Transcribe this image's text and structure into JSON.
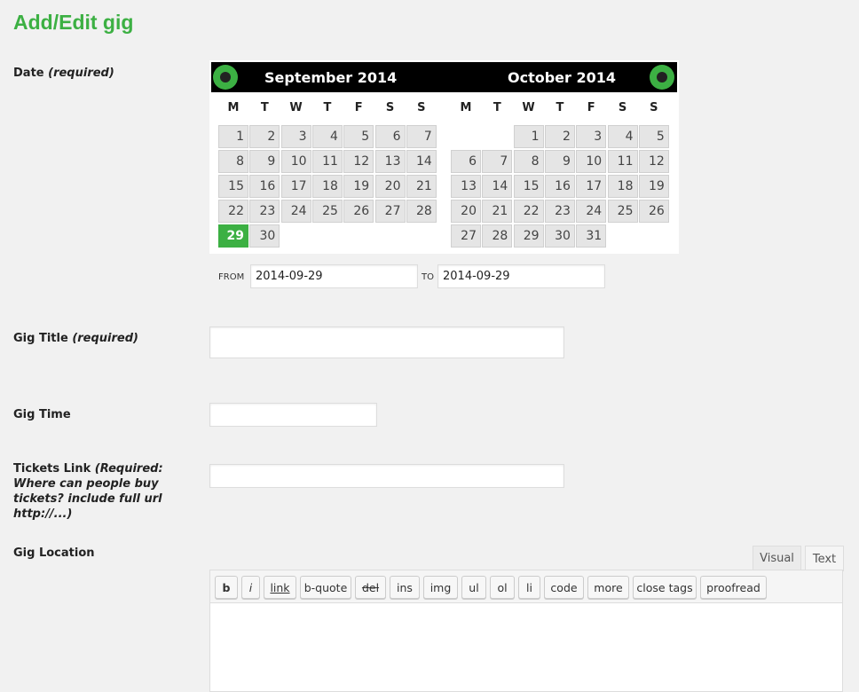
{
  "page_title": "Add/Edit gig",
  "fields": {
    "date": {
      "label": "Date",
      "note": "(required)"
    },
    "title": {
      "label": "Gig Title",
      "note": "(required)",
      "value": ""
    },
    "time": {
      "label": "Gig Time",
      "value": ""
    },
    "tickets": {
      "label": "Tickets Link",
      "note": "(Required: Where can people buy tickets? include full url http://...)",
      "value": ""
    },
    "location": {
      "label": "Gig Location",
      "value": ""
    }
  },
  "calendar": {
    "accent": "#3cb043",
    "prev_icon": "arrow-left-circle",
    "next_icon": "arrow-right-circle",
    "weekdays": [
      "M",
      "T",
      "W",
      "T",
      "F",
      "S",
      "S"
    ],
    "months": [
      {
        "title": "September 2014",
        "first_weekday": 0,
        "days": 30,
        "selected": 29
      },
      {
        "title": "October 2014",
        "first_weekday": 2,
        "days": 31,
        "selected": null
      }
    ],
    "from_label": "FROM",
    "from_value": "2014-09-29",
    "to_label": "TO",
    "to_value": "2014-09-29"
  },
  "editor": {
    "tabs": [
      "Visual",
      "Text"
    ],
    "active_tab": "Text",
    "buttons": [
      "b",
      "i",
      "link",
      "b-quote",
      "del",
      "ins",
      "img",
      "ul",
      "ol",
      "li",
      "code",
      "more",
      "close tags",
      "proofread"
    ]
  }
}
